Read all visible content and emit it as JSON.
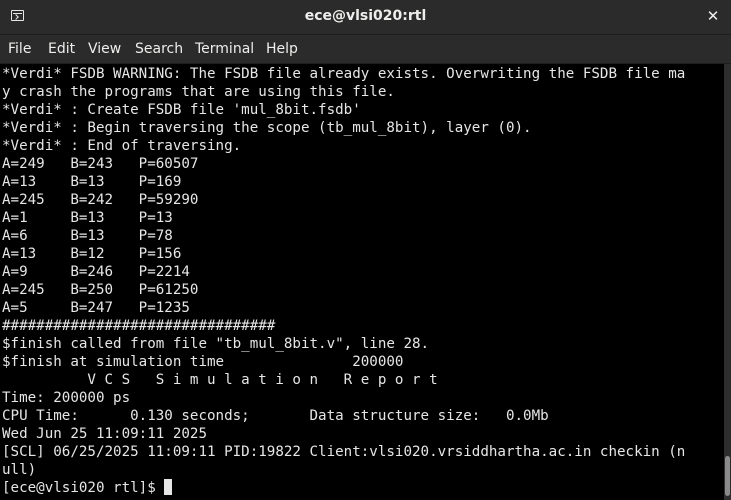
{
  "window": {
    "title": "ece@vlsi020:rtl",
    "icon": "terminal-icon",
    "close_glyph": "✕"
  },
  "menu": [
    "File",
    "Edit",
    "View",
    "Search",
    "Terminal",
    "Help"
  ],
  "terminal": {
    "lines": [
      "*Verdi* FSDB WARNING: The FSDB file already exists. Overwriting the FSDB file ma",
      "y crash the programs that are using this file.",
      "*Verdi* : Create FSDB file 'mul_8bit.fsdb'",
      "*Verdi* : Begin traversing the scope (tb_mul_8bit), layer (0).",
      "*Verdi* : End of traversing.",
      "A=249   B=243   P=60507",
      "A=13    B=13    P=169",
      "A=245   B=242   P=59290",
      "A=1     B=13    P=13",
      "A=6     B=13    P=78",
      "A=13    B=12    P=156",
      "A=9     B=246   P=2214",
      "A=245   B=250   P=61250",
      "A=5     B=247   P=1235",
      "################################",
      "$finish called from file \"tb_mul_8bit.v\", line 28.",
      "$finish at simulation time               200000",
      "          V C S   S i m u l a t i o n   R e p o r t",
      "Time: 200000 ps",
      "CPU Time:      0.130 seconds;       Data structure size:   0.0Mb",
      "Wed Jun 25 11:09:11 2025",
      "[SCL] 06/25/2025 11:09:11 PID:19822 Client:vlsi020.vrsiddhartha.ac.in checkin (n",
      "ull)"
    ],
    "prompt": "[ece@vlsi020 rtl]$ "
  },
  "colors": {
    "titlebar_bg": "#2b2b2b",
    "terminal_bg": "#000000",
    "terminal_fg": "#e6e6e6"
  }
}
